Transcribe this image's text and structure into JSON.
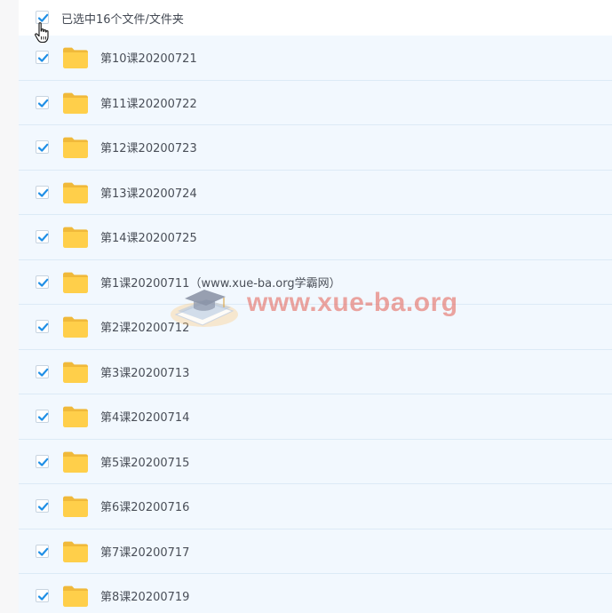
{
  "header": {
    "selection_text": "已选中16个文件/文件夹",
    "all_checked": true
  },
  "folders": [
    {
      "name": "第10课20200721",
      "checked": true
    },
    {
      "name": "第11课20200722",
      "checked": true
    },
    {
      "name": "第12课20200723",
      "checked": true
    },
    {
      "name": "第13课20200724",
      "checked": true
    },
    {
      "name": "第14课20200725",
      "checked": true
    },
    {
      "name": "第1课20200711（www.xue-ba.org学霸网）",
      "checked": true
    },
    {
      "name": "第2课20200712",
      "checked": true
    },
    {
      "name": "第3课20200713",
      "checked": true
    },
    {
      "name": "第4课20200714",
      "checked": true
    },
    {
      "name": "第5课20200715",
      "checked": true
    },
    {
      "name": "第6课20200716",
      "checked": true
    },
    {
      "name": "第7课20200717",
      "checked": true
    },
    {
      "name": "第8课20200719",
      "checked": true
    }
  ],
  "watermark": {
    "text": "www.xue-ba.org",
    "icon": "graduation-cap-book-icon"
  },
  "icons": {
    "checkbox": "checkmark-icon",
    "folder": "folder-icon",
    "cursor": "hand-pointer-icon"
  },
  "colors": {
    "check": "#1f8fe6",
    "folder": "#ffcf4a",
    "row_bg": "#f2f8fe",
    "row_divider": "#dceaf6",
    "watermark": "#e45c50"
  }
}
